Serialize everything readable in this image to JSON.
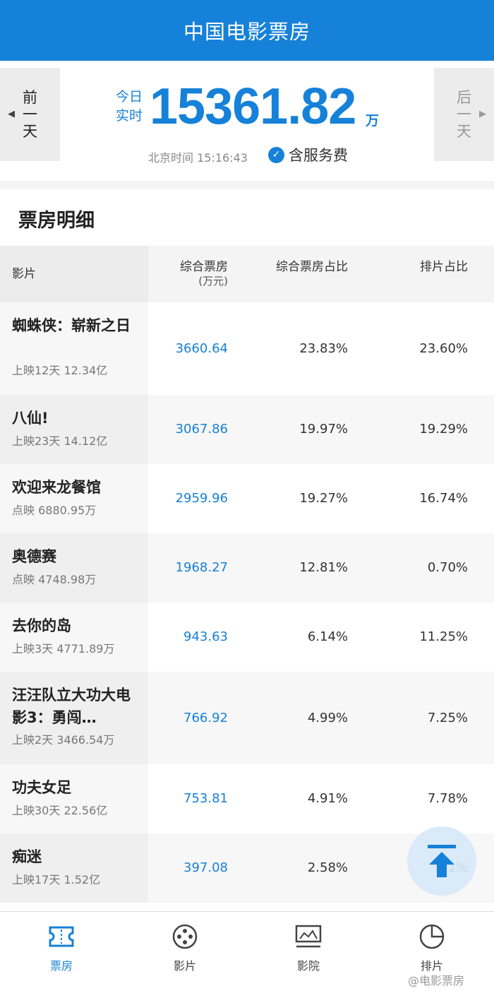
{
  "app": {
    "title": "中国电影票房"
  },
  "summary": {
    "prev_day": "前一天",
    "next_day": "后一天",
    "today_label": "今日实时",
    "total": "15361.82",
    "unit": "万",
    "clock": "北京时间 15:16:43",
    "service_label": "含服务费"
  },
  "detail": {
    "title": "票房明细",
    "headers": {
      "name": "影片",
      "box": "综合票房",
      "box_unit": "(万元)",
      "share": "综合票房占比",
      "schedule": "排片占比"
    },
    "rows": [
      {
        "name": "蜘蛛侠：崭新之日",
        "info": "上映12天 12.34亿",
        "box": "3660.64",
        "share": "23.83%",
        "schedule": "23.60%"
      },
      {
        "name": "八仙!",
        "info": "上映23天 14.12亿",
        "box": "3067.86",
        "share": "19.97%",
        "schedule": "19.29%"
      },
      {
        "name": "欢迎来龙餐馆",
        "info": "点映 6880.95万",
        "box": "2959.96",
        "share": "19.27%",
        "schedule": "16.74%"
      },
      {
        "name": "奥德赛",
        "info": "点映 4748.98万",
        "box": "1968.27",
        "share": "12.81%",
        "schedule": "0.70%"
      },
      {
        "name": "去你的岛",
        "info": "上映3天 4771.89万",
        "box": "943.63",
        "share": "6.14%",
        "schedule": "11.25%"
      },
      {
        "name": "汪汪队立大功大电影3：勇闯…",
        "info": "上映2天 3466.54万",
        "box": "766.92",
        "share": "4.99%",
        "schedule": "7.25%"
      },
      {
        "name": "功夫女足",
        "info": "上映30天 22.56亿",
        "box": "753.81",
        "share": "4.91%",
        "schedule": "7.78%"
      },
      {
        "name": "痴迷",
        "info": "上映17天 1.52亿",
        "box": "397.08",
        "share": "2.58%",
        "schedule": "4.1%"
      }
    ]
  },
  "nav": {
    "items": [
      {
        "label": "票房",
        "icon": "ticket-icon",
        "active": true
      },
      {
        "label": "影片",
        "icon": "film-reel-icon",
        "active": false
      },
      {
        "label": "影院",
        "icon": "cinema-icon",
        "active": false
      },
      {
        "label": "排片",
        "icon": "pie-chart-icon",
        "active": false
      }
    ]
  },
  "watermark": "@电影票房",
  "colors": {
    "brand": "#1681d8",
    "muted": "#888888"
  }
}
